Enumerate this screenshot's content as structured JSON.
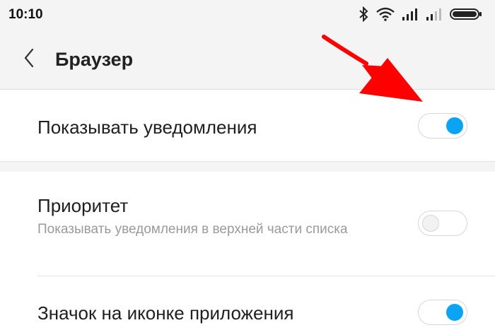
{
  "status_bar": {
    "time": "10:10",
    "icons": [
      "bluetooth-icon",
      "wifi-icon",
      "signal-icon",
      "signal-icon-2",
      "battery-icon"
    ]
  },
  "toolbar": {
    "back_icon": "chevron-left-icon",
    "title": "Браузер"
  },
  "settings": [
    {
      "title": "Показывать уведомления",
      "subtitle": "",
      "enabled": true
    },
    {
      "title": "Приоритет",
      "subtitle": "Показывать уведомления в верхней части списка",
      "enabled": false
    },
    {
      "title": "Значок на иконке приложения",
      "subtitle": "",
      "enabled": true
    }
  ],
  "colors": {
    "toggle_on": "#0ba4f4",
    "annotation_arrow": "#ff0000",
    "bar_background": "#f4f4f4"
  },
  "annotation": {
    "type": "hand-drawn-arrow",
    "points_to": "Показывать уведомления toggle"
  }
}
